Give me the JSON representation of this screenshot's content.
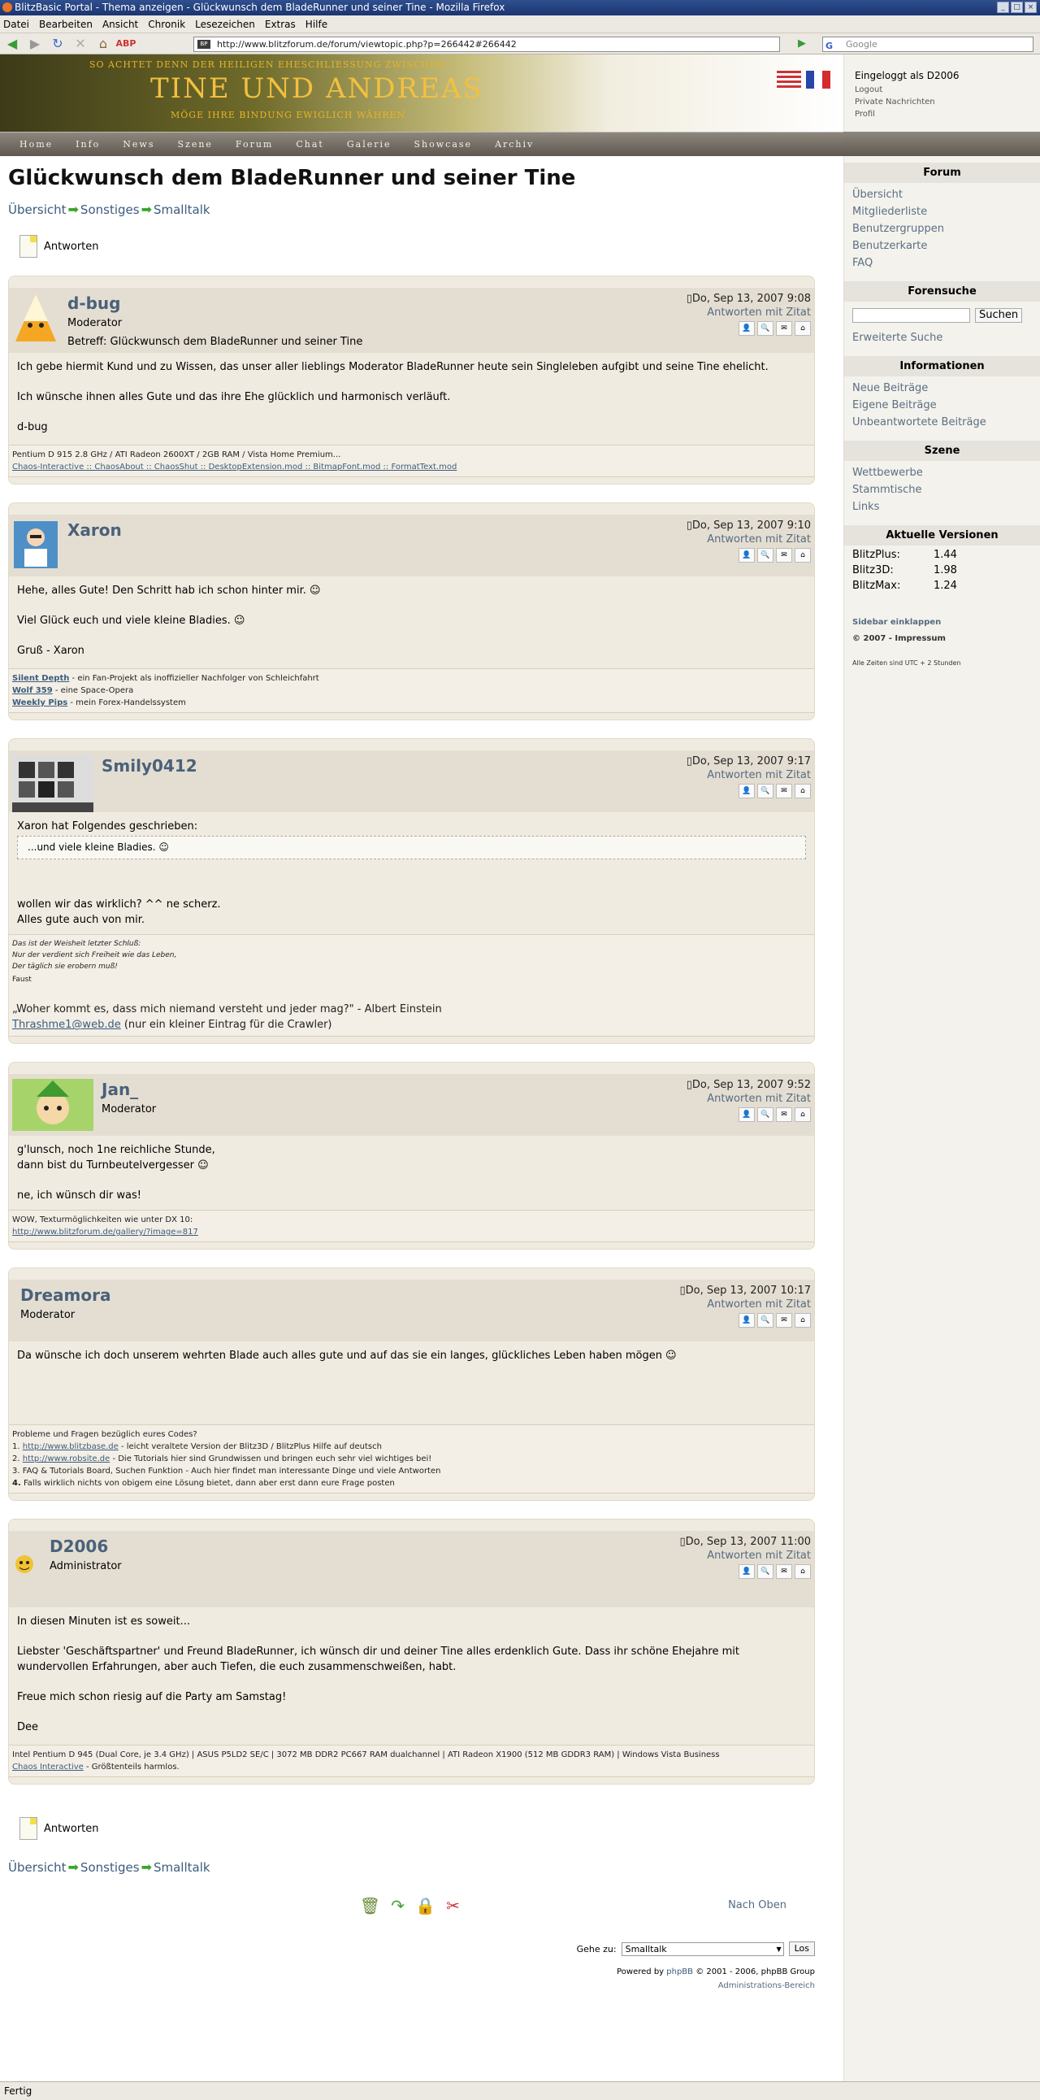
{
  "window": {
    "title": "BlitzBasic Portal - Thema anzeigen - Glückwunsch dem BladeRunner und seiner Tine - Mozilla Firefox"
  },
  "menu": [
    "Datei",
    "Bearbeiten",
    "Ansicht",
    "Chronik",
    "Lesezeichen",
    "Extras",
    "Hilfe"
  ],
  "url": "http://www.blitzforum.de/forum/viewtopic.php?p=266442#266442",
  "search_placeholder": "Google",
  "banner": {
    "line1": "SO ACHTET DENN DER HEILIGEN EHESCHLIESSUNG ZWISCHEN",
    "line2": "TINE UND ANDREAS",
    "line3": "MÖGE IHRE BINDUNG EWIGLICH WÄHREN"
  },
  "topnav": [
    "Home",
    "Info",
    "News",
    "Szene",
    "Forum",
    "Chat",
    "Galerie",
    "Showcase",
    "Archiv"
  ],
  "login": {
    "text": "Eingeloggt als D2006",
    "links": [
      "Logout",
      "Private Nachrichten",
      "Profil"
    ]
  },
  "sidebar": {
    "forum_title": "Forum",
    "forum_links": [
      "Übersicht",
      "Mitgliederliste",
      "Benutzergruppen",
      "Benutzerkarte",
      "FAQ"
    ],
    "search_title": "Forensuche",
    "search_button": "Suchen",
    "search_link": "Erweiterte Suche",
    "info_title": "Informationen",
    "info_links": [
      "Neue Beiträge",
      "Eigene Beiträge",
      "Unbeantwortete Beiträge"
    ],
    "scene_title": "Szene",
    "scene_links": [
      "Wettbewerbe",
      "Stammtische",
      "Links"
    ],
    "versions_title": "Aktuelle Versionen",
    "versions": [
      {
        "name": "BlitzPlus:",
        "v": "1.44"
      },
      {
        "name": "Blitz3D:",
        "v": "1.98"
      },
      {
        "name": "BlitzMax:",
        "v": "1.24"
      }
    ],
    "collapse": "Sidebar einklappen",
    "copyright": "© 2007 - Impressum",
    "tz": "Alle Zeiten sind UTC + 2 Stunden"
  },
  "page": {
    "title": "Glückwunsch dem BladeRunner und seiner Tine",
    "crumbs": [
      "Übersicht",
      "Sonstiges",
      "Smalltalk"
    ],
    "reply": "Antworten"
  },
  "quote_label": "Antworten mit Zitat",
  "posts": [
    {
      "user": "d-bug",
      "rank": "Moderator",
      "date": "Do, Sep 13, 2007 9:08",
      "subject": "Betreff: Glückwunsch dem BladeRunner und seiner Tine",
      "body": [
        "Ich gebe hiermit Kund und zu Wissen, das unser aller lieblings Moderator BladeRunner heute sein Singleleben aufgibt und seine Tine ehelicht.",
        "Ich wünsche ihnen alles Gute und das ihre Ehe glücklich und harmonisch verläuft.",
        "d-bug"
      ],
      "sig1": "Pentium D 915 2.8 GHz / ATI Radeon 2600XT / 2GB RAM / Vista Home Premium...",
      "sig2": "Chaos-Interactive :: ChaosAbout :: ChaosShut :: DesktopExtension.mod :: BitmapFont.mod :: FormatText.mod"
    },
    {
      "user": "Xaron",
      "rank": "",
      "date": "Do, Sep 13, 2007 9:10",
      "body": [
        "Hehe, alles Gute! Den Schritt hab ich schon hinter mir. ☺",
        "Viel Glück euch und viele kleine Bladies. ☺",
        "Gruß - Xaron"
      ],
      "sigs": [
        {
          "link": "Silent Depth",
          "text": " - ein Fan-Projekt als inoffizieller Nachfolger von Schleichfahrt"
        },
        {
          "link": "Wolf 359",
          "text": " - eine Space-Opera"
        },
        {
          "link": "Weekly Pips",
          "text": " - mein Forex-Handelssystem"
        }
      ]
    },
    {
      "user": "Smily0412",
      "rank": "",
      "date": "Do, Sep 13, 2007 9:17",
      "quote_by": "Xaron hat Folgendes geschrieben:",
      "quote": "...und viele kleine Bladies. ☺",
      "body": [
        "wollen wir das wirklich? ^^ ne scherz.",
        "Alles gute auch von mir."
      ],
      "sig_lines": [
        "Das ist der Weisheit letzter Schluß:",
        "Nur der verdient sich Freiheit wie das Leben,",
        "Der täglich sie erobern muß!",
        "Faust"
      ],
      "sig_quote": "„Woher kommt es, dass mich niemand versteht und jeder mag?\" - Albert Einstein",
      "sig_mail": "Thrashme1@web.de",
      "sig_mail_note": " (nur ein kleiner Eintrag für die Crawler)"
    },
    {
      "user": "Jan_",
      "rank": "Moderator",
      "date": "Do, Sep 13, 2007 9:52",
      "body": [
        "g'lunsch, noch 1ne reichliche Stunde,",
        "dann bist du Turnbeutelvergesser ☺",
        "ne, ich wünsch dir was!"
      ],
      "sig_text": "WOW, Texturmöglichkeiten wie unter DX 10:",
      "sig_link": "http://www.blitzforum.de/gallery/?image=817"
    },
    {
      "user": "Dreamora",
      "rank": "Moderator",
      "date": "Do, Sep 13, 2007 10:17",
      "body": [
        "Da wünsche ich doch unserem wehrten Blade auch alles gute und auf das sie ein langes, glückliches Leben haben mögen ☺"
      ],
      "sig_intro": "Probleme und Fragen bezüglich eures Codes?",
      "sig_items": [
        {
          "n": "1.",
          "link": "http://www.blitzbase.de",
          "text": " - leicht veraltete Version der Blitz3D / BlitzPlus Hilfe auf deutsch"
        },
        {
          "n": "2.",
          "link": "http://www.robsite.de",
          "text": " - Die Tutorials hier sind Grundwissen und bringen euch sehr viel wichtiges bei!"
        },
        {
          "n": "3.",
          "link": "",
          "text": "FAQ & Tutorials Board, Suchen Funktion - Auch hier findet man interessante Dinge und viele Antworten"
        },
        {
          "n": "4.",
          "link": "",
          "text": "Falls wirklich nichts von obigem eine Lösung bietet, dann aber erst dann eure Frage posten"
        }
      ]
    },
    {
      "user": "D2006",
      "rank": "Administrator",
      "date": "Do, Sep 13, 2007 11:00",
      "body": [
        "In diesen Minuten ist es soweit...",
        "Liebster 'Geschäftspartner' und Freund BladeRunner, ich wünsch dir und deiner Tine alles erdenklich Gute. Dass ihr schöne Ehejahre mit wundervollen Erfahrungen, aber auch Tiefen, die euch zusammenschweißen, habt.",
        "Freue mich schon riesig auf die Party am Samstag!",
        "Dee"
      ],
      "sig1": "Intel Pentium D 945 (Dual Core, je 3.4 GHz) | ASUS P5LD2 SE/C | 3072 MB DDR2 PC667 RAM dualchannel | ATI Radeon X1900 (512 MB GDDR3 RAM) | Windows Vista Business",
      "sig_link": "Chaos Interactive",
      "sig_after": " - Größtenteils harmlos."
    }
  ],
  "bottom": {
    "nach_oben": "Nach Oben",
    "gehe_label": "Gehe zu:",
    "gehe_value": "Smalltalk",
    "gehe_btn": "Los",
    "powered_pre": "Powered by ",
    "powered_link": "phpBB",
    "powered_post": " © 2001 - 2006, phpBB Group",
    "admin": "Administrations-Bereich"
  },
  "status": "Fertig"
}
